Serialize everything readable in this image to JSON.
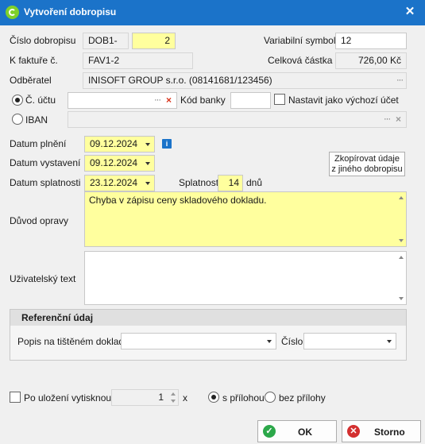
{
  "window": {
    "title": "Vytvoření dobropisu",
    "close": "✕"
  },
  "form": {
    "cislo_dobropisu_label": "Číslo dobropisu",
    "cislo_prefix": "DOB1-",
    "cislo_value": "2",
    "variabilni_symbol_label": "Variabilní symbol",
    "variabilni_symbol_value": "12",
    "k_fakture_label": "K faktuře č.",
    "k_fakture_value": "FAV1-2",
    "celkova_castka_label": "Celková částka",
    "celkova_castka_value": "726,00 Kč",
    "odberatel_label": "Odběratel",
    "odberatel_value": "INISOFT GROUP s.r.o. (08141681/123456)",
    "cislo_uctu_label": "Č. účtu",
    "cislo_uctu_value": "",
    "kod_banky_label": "Kód banky",
    "kod_banky_value": "",
    "nastavit_vychozi_label": "Nastavit jako výchozí účet",
    "iban_label": "IBAN",
    "iban_value": "",
    "datum_plneni_label": "Datum plnění",
    "datum_plneni_value": "09.12.2024",
    "datum_vystaveni_label": "Datum vystavení",
    "datum_vystaveni_value": "09.12.2024",
    "datum_splatnosti_label": "Datum splatnosti",
    "datum_splatnosti_value": "23.12.2024",
    "splatnost_label": "Splatnost",
    "splatnost_value": "14",
    "splatnost_unit": "dnů",
    "kopirovat_line1": "Zkopírovat údaje",
    "kopirovat_line2": "z jiného dobropisu",
    "duvod_opravy_label": "Důvod opravy",
    "duvod_opravy_value": "Chyba v zápisu ceny skladového dokladu.",
    "uzivatelsky_text_label": "Uživatelský text",
    "uzivatelsky_text_value": ""
  },
  "reference": {
    "title": "Referenční údaj",
    "popis_label": "Popis na tištěném dokladu",
    "popis_value": "",
    "cislo_label": "Číslo",
    "cislo_value": ""
  },
  "footer": {
    "po_ulozeni_label": "Po uložení vytisknout",
    "copies_value": "1",
    "copies_unit": "x",
    "s_prilohou_label": "s přílohou",
    "bez_prilohy_label": "bez přílohy",
    "ok_label": "OK",
    "storno_label": "Storno"
  },
  "colors": {
    "titlebar": "#1b73c9",
    "required_field": "#ffff9e",
    "info_icon": "#1b73c9",
    "ok_icon": "#2ca84a",
    "cancel_icon": "#d32f2f"
  }
}
